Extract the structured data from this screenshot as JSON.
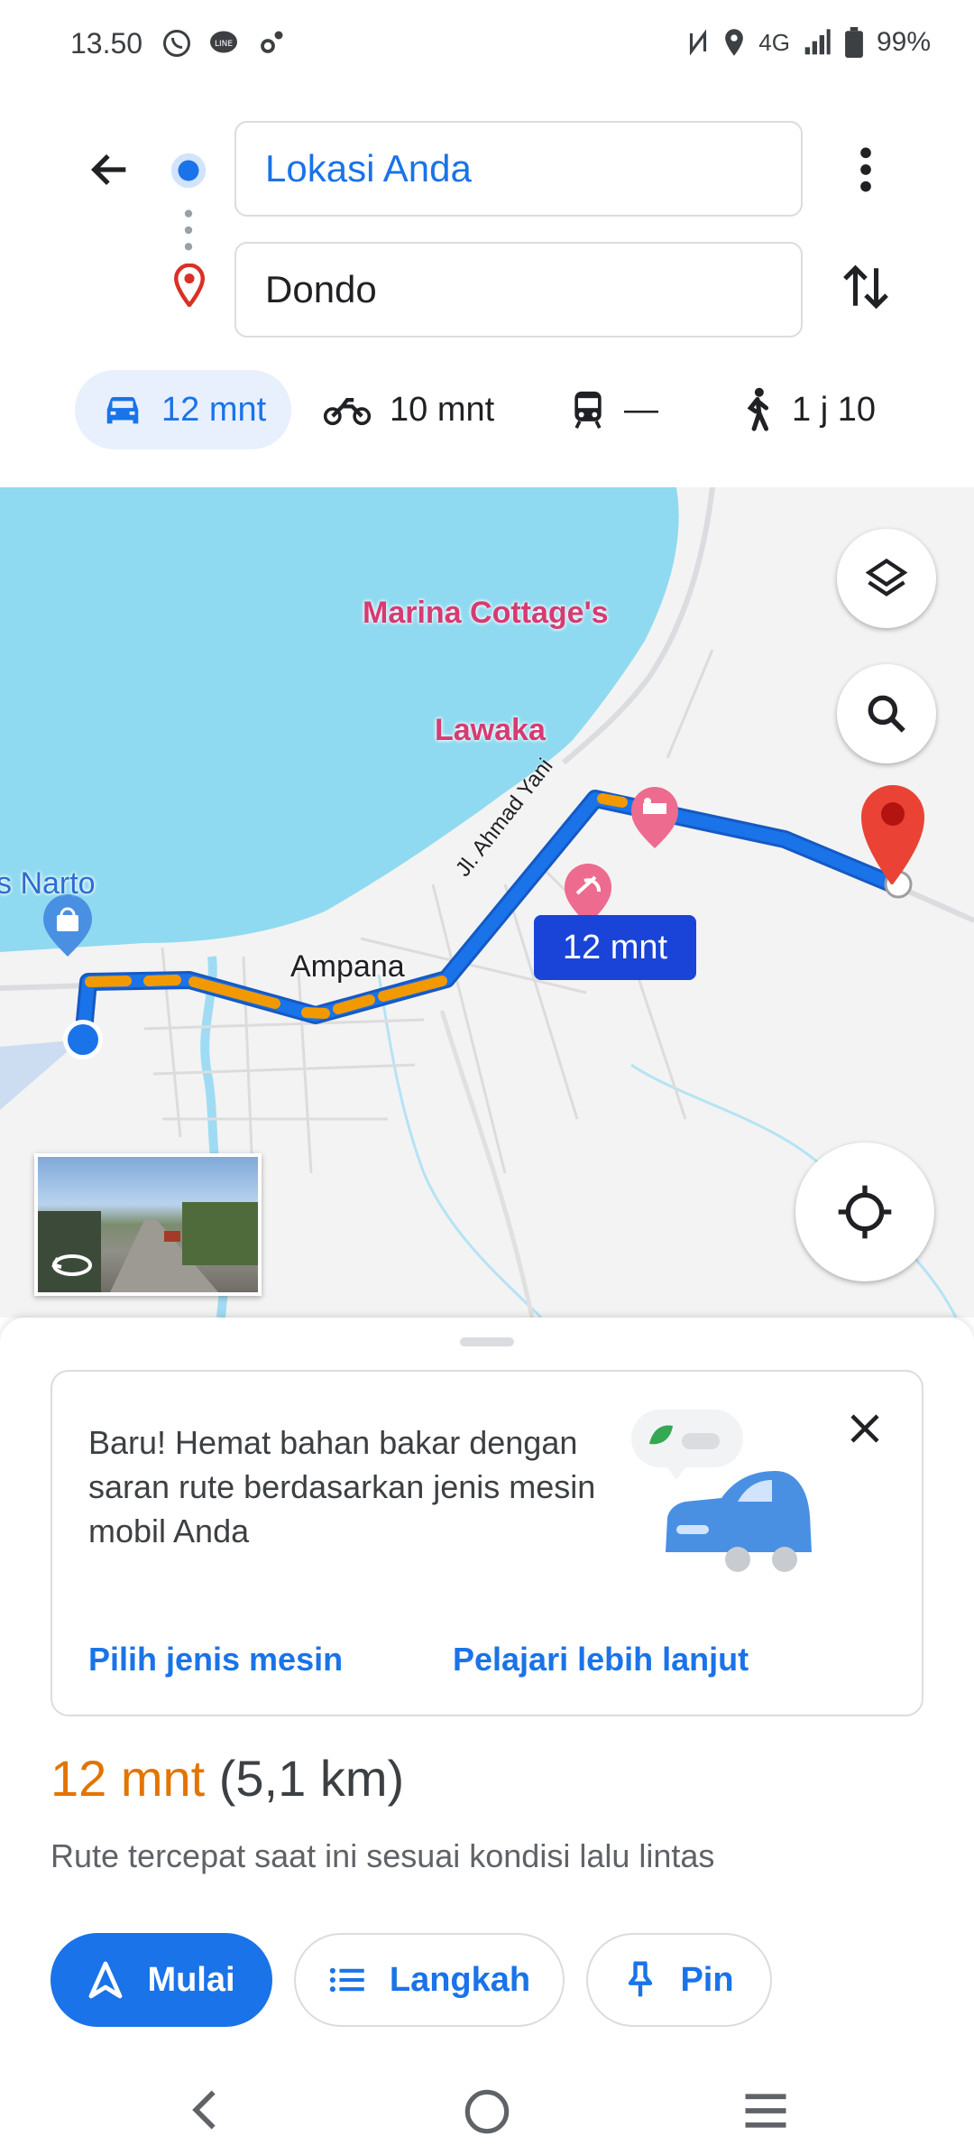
{
  "status": {
    "time": "13.50",
    "network": "4G",
    "battery": "99%"
  },
  "directions": {
    "origin": "Lokasi Anda",
    "destination": "Dondo",
    "modes": [
      {
        "icon": "car-icon",
        "label": "12 mnt"
      },
      {
        "icon": "motorcycle-icon",
        "label": "10 mnt"
      },
      {
        "icon": "transit-icon",
        "label": "—"
      },
      {
        "icon": "walk-icon",
        "label": "1 j 10"
      }
    ]
  },
  "map": {
    "place_labels": {
      "marina": "Marina Cottage's",
      "lawaka": "Lawaka",
      "narto": "s Narto",
      "ampana": "Ampana",
      "street": "Jl. Ahmad Yani"
    },
    "route_label": "12 mnt"
  },
  "promo": {
    "text": "Baru! Hemat bahan bakar dengan saran rute berdasarkan jenis mesin mobil Anda",
    "link_engine": "Pilih jenis mesin",
    "link_learn": "Pelajari lebih lanjut"
  },
  "route": {
    "eta": "12 mnt",
    "distance": "(5,1 km)",
    "description": "Rute tercepat saat ini sesuai kondisi lalu lintas"
  },
  "actions": {
    "start": "Mulai",
    "steps": "Langkah",
    "pin": "Pin"
  },
  "colors": {
    "accent": "#1a73e8",
    "traffic": "#f29900",
    "water": "#8fdaf0",
    "eta": "#e37400"
  }
}
